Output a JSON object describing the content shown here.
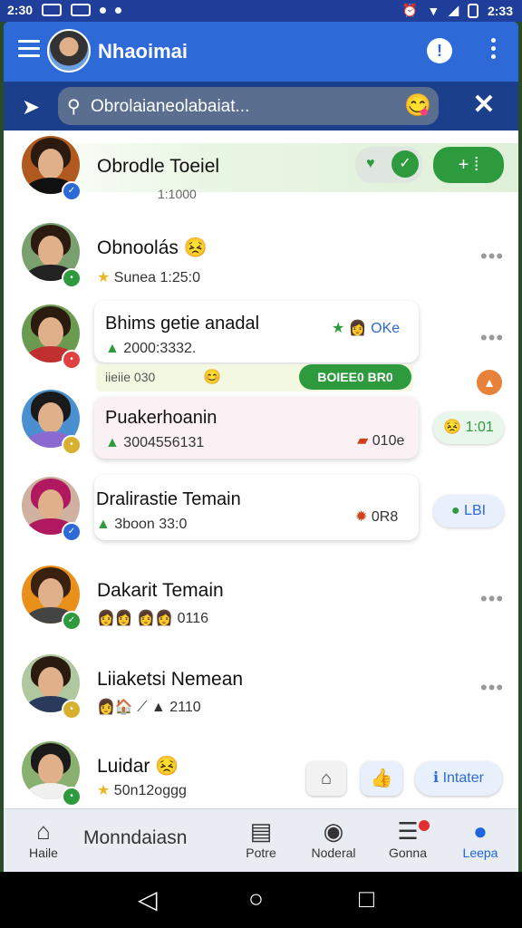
{
  "status_bar": {
    "time": "2:30",
    "right": "2:33"
  },
  "app_bar": {
    "title": "Nhaoimai"
  },
  "search": {
    "placeholder": "Obrolaianeolabaiat..."
  },
  "chats": [
    {
      "name": "Obrodle Toeiel",
      "sub": "1:1000",
      "badge_color": "#2d6ad8"
    },
    {
      "name": "Obnoolás",
      "sub": "Sunea 1:25:0",
      "badge_color": "#2e9a3e"
    },
    {
      "name": "Bhims getie anadal",
      "sub": "2000:3332.",
      "badge_color": "#e04040",
      "tag": "OKe"
    },
    {
      "name": "Puakerhoanin",
      "sub": "3004556131",
      "badge_color": "#d8b030",
      "tag": "010e"
    },
    {
      "name": "Dralirastie Temain",
      "sub": "3boon 33:0",
      "badge_color": "#2d6ad8",
      "tag": "0R8"
    },
    {
      "name": "Dakarit Temain",
      "sub": "0116",
      "badge_color": "#2e9a3e"
    },
    {
      "name": "Liiaketsi Nemean",
      "sub": "2110",
      "badge_color": "#d8b030"
    },
    {
      "name": "Luidar",
      "sub": "50n12oggg",
      "badge_color": "#2e9a3e"
    }
  ],
  "banner_1": {
    "text": "iieiie 030"
  },
  "banner_2": {
    "text": "BOIEE0 BR0"
  },
  "pill_1": {
    "text": "1:01"
  },
  "pill_2": {
    "text": "LBI"
  },
  "intatter": {
    "label": "Intater"
  },
  "bottom_nav": {
    "center": "Monndaiasn",
    "items": [
      {
        "label": "Haile",
        "icon": "home-icon"
      },
      {
        "label": "Potre",
        "icon": "document-icon"
      },
      {
        "label": "Noderal",
        "icon": "globe-icon"
      },
      {
        "label": "Gonna",
        "icon": "list-icon"
      },
      {
        "label": "Leepa",
        "icon": "person-icon"
      }
    ]
  },
  "colors": {
    "primary": "#2d6ad8",
    "green": "#2e9a3e",
    "appbar_dark": "#1c3f8c"
  }
}
